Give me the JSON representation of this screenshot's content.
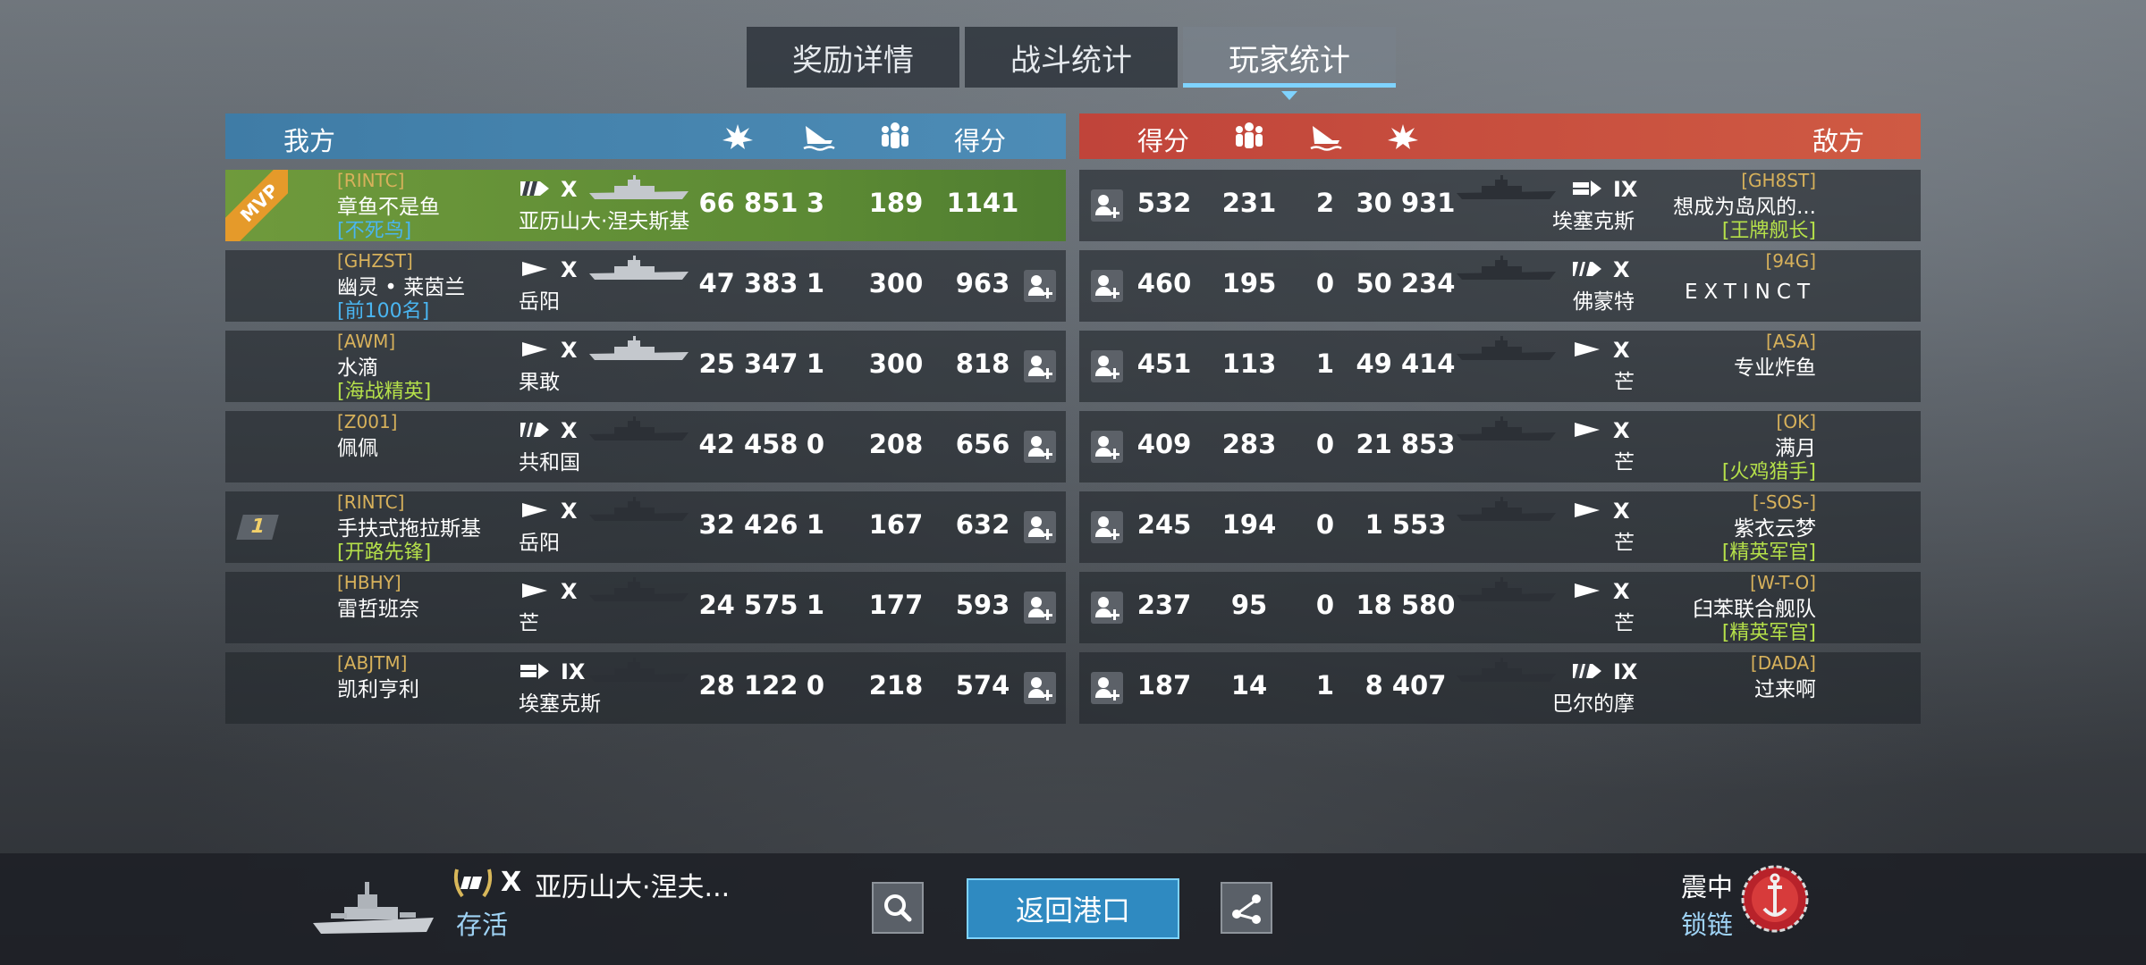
{
  "tabs": [
    {
      "label": "奖励详情"
    },
    {
      "label": "战斗统计"
    },
    {
      "label": "玩家统计"
    }
  ],
  "left_team": {
    "name": "我方",
    "score_label": "得分",
    "players": [
      {
        "clan": "[RINTC]",
        "name": "章鱼不是鱼",
        "title": "[不死鸟]",
        "title_color": "blue",
        "tier": "X",
        "ship": "亚历山大·涅夫斯基",
        "damage": "66 851",
        "kills": "3",
        "assists": "189",
        "score": "1141",
        "mvp": true,
        "rank": ""
      },
      {
        "clan": "[GHZST]",
        "name": "幽灵 • 莱茵兰",
        "title": "[前100名]",
        "title_color": "blue",
        "tier": "X",
        "ship": "岳阳",
        "damage": "47 383",
        "kills": "1",
        "assists": "300",
        "score": "963",
        "mvp": false,
        "rank": ""
      },
      {
        "clan": "[AWM]",
        "name": "水滴",
        "title": "[海战精英]",
        "title_color": "green",
        "tier": "X",
        "ship": "果敢",
        "damage": "25 347",
        "kills": "1",
        "assists": "300",
        "score": "818",
        "mvp": false,
        "rank": ""
      },
      {
        "clan": "[Z001]",
        "name": "佩佩",
        "title": "",
        "title_color": "",
        "tier": "X",
        "ship": "共和国",
        "damage": "42 458",
        "kills": "0",
        "assists": "208",
        "score": "656",
        "mvp": false,
        "rank": ""
      },
      {
        "clan": "[RINTC]",
        "name": "手扶式拖拉斯基",
        "title": "[开路先锋]",
        "title_color": "green",
        "tier": "X",
        "ship": "岳阳",
        "damage": "32 426",
        "kills": "1",
        "assists": "167",
        "score": "632",
        "mvp": false,
        "rank": "1"
      },
      {
        "clan": "[HBHY]",
        "name": "雷哲班奈",
        "title": "",
        "title_color": "",
        "tier": "X",
        "ship": "芒",
        "damage": "24 575",
        "kills": "1",
        "assists": "177",
        "score": "593",
        "mvp": false,
        "rank": ""
      },
      {
        "clan": "[ABJTM]",
        "name": "凯利亨利",
        "title": "",
        "title_color": "",
        "tier": "IX",
        "ship": "埃塞克斯",
        "damage": "28 122",
        "kills": "0",
        "assists": "218",
        "score": "574",
        "mvp": false,
        "rank": ""
      }
    ]
  },
  "right_team": {
    "name": "敌方",
    "score_label": "得分",
    "players": [
      {
        "clan": "[GH8ST]",
        "name": "想成为岛风的...",
        "title": "[王牌舰长]",
        "title_color": "green",
        "tier": "IX",
        "ship": "埃塞克斯",
        "damage": "30 931",
        "kills": "2",
        "assists": "231",
        "score": "532"
      },
      {
        "clan": "[94G]",
        "name": "EXTINCT",
        "title": "",
        "title_color": "",
        "tier": "X",
        "ship": "佛蒙特",
        "damage": "50 234",
        "kills": "0",
        "assists": "195",
        "score": "460"
      },
      {
        "clan": "[ASA]",
        "name": "专业炸鱼",
        "title": "",
        "title_color": "",
        "tier": "X",
        "ship": "芒",
        "damage": "49 414",
        "kills": "1",
        "assists": "113",
        "score": "451"
      },
      {
        "clan": "[OK]",
        "name": "满月",
        "title": "[火鸡猎手]",
        "title_color": "green",
        "tier": "X",
        "ship": "芒",
        "damage": "21 853",
        "kills": "0",
        "assists": "283",
        "score": "409"
      },
      {
        "clan": "[-SOS-]",
        "name": "紫衣云梦",
        "title": "[精英军官]",
        "title_color": "green",
        "tier": "X",
        "ship": "芒",
        "damage": "1 553",
        "kills": "0",
        "assists": "194",
        "score": "245"
      },
      {
        "clan": "[W-T-O]",
        "name": "臼苯联合舰队",
        "title": "[精英军官]",
        "title_color": "green",
        "tier": "X",
        "ship": "芒",
        "damage": "18 580",
        "kills": "0",
        "assists": "95",
        "score": "237"
      },
      {
        "clan": "[DADA]",
        "name": "过来啊",
        "title": "",
        "title_color": "",
        "tier": "IX",
        "ship": "巴尔的摩",
        "damage": "8 407",
        "kills": "1",
        "assists": "14",
        "score": "187"
      }
    ]
  },
  "bottom": {
    "ship_tier": "X",
    "ship_name": "亚历山大·涅夫...",
    "status": "存活",
    "return_label": "返回港口",
    "achievement_line1": "震中",
    "achievement_line2": "锁链"
  },
  "mvp_badge": "MVP",
  "icons": {
    "damage": "explosion-icon",
    "kills": "sinking-ship-icon",
    "assists": "team-icon",
    "search": "search-icon",
    "share": "share-icon"
  },
  "colors": {
    "ally_header": "#4d8cb6",
    "enemy_header": "#cf5a43",
    "mvp_row": "#6f9a3c",
    "clan_tag": "#d7b15b",
    "title_blue": "#4ab5f0",
    "title_green": "#b5e04a",
    "accent": "#7fd3ff"
  }
}
